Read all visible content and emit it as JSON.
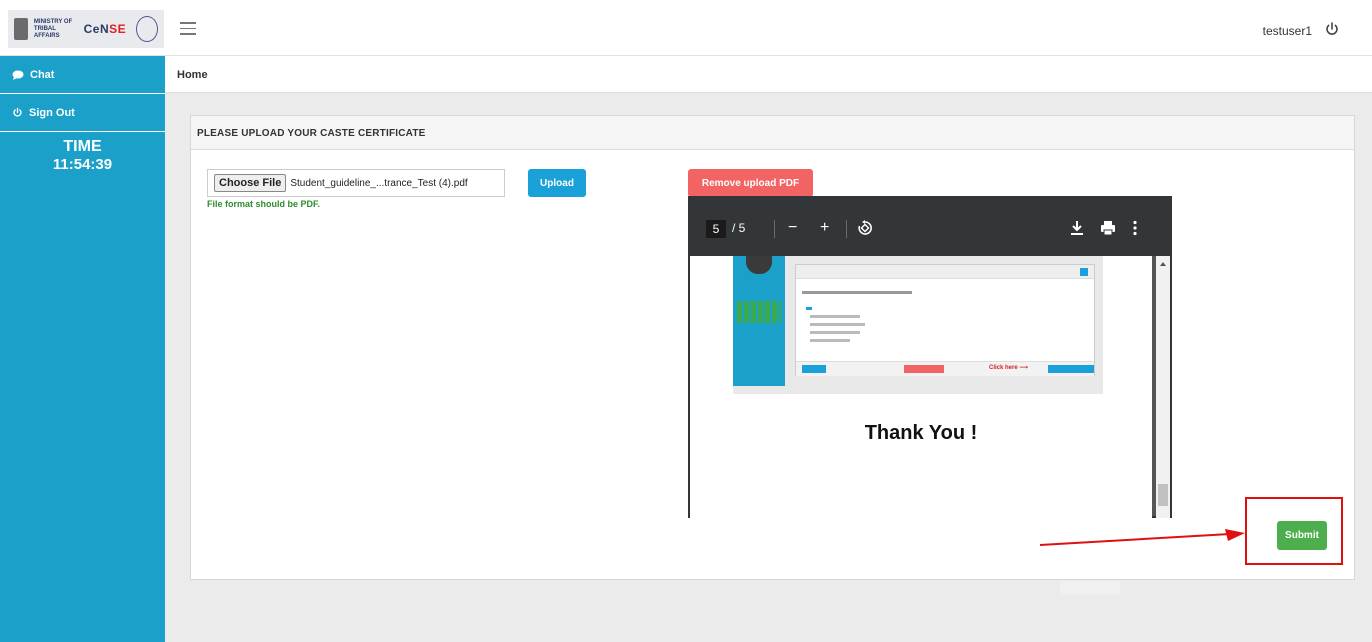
{
  "header": {
    "logo": {
      "ministry_text": "MINISTRY OF TRIBAL AFFAIRS",
      "brand_prefix": "CeN",
      "brand_suffix": "SE"
    },
    "username": "testuser1"
  },
  "sidebar": {
    "items": [
      {
        "label": "Chat",
        "icon": "chat-icon"
      },
      {
        "label": "Sign Out",
        "icon": "power-icon"
      }
    ],
    "time_label": "TIME",
    "time_value": "11:54:39"
  },
  "breadcrumb": {
    "current": "Home"
  },
  "panel": {
    "title": "PLEASE UPLOAD YOUR CASTE CERTIFICATE",
    "choose_file_label": "Choose File",
    "file_name": "Student_guideline_...trance_Test (4).pdf",
    "file_hint": "File format should be PDF.",
    "upload_label": "Upload",
    "remove_label": "Remove upload PDF",
    "submit_label": "Submit"
  },
  "pdf_viewer": {
    "current_page": "5",
    "total_pages": "/ 5",
    "page_content": {
      "click_here": "Click here",
      "thank_you": "Thank You !"
    }
  },
  "colors": {
    "sidebar": "#1ba1c9",
    "upload": "#1ba1d9",
    "remove": "#f26464",
    "submit": "#4cae4c",
    "highlight": "#e01010"
  }
}
